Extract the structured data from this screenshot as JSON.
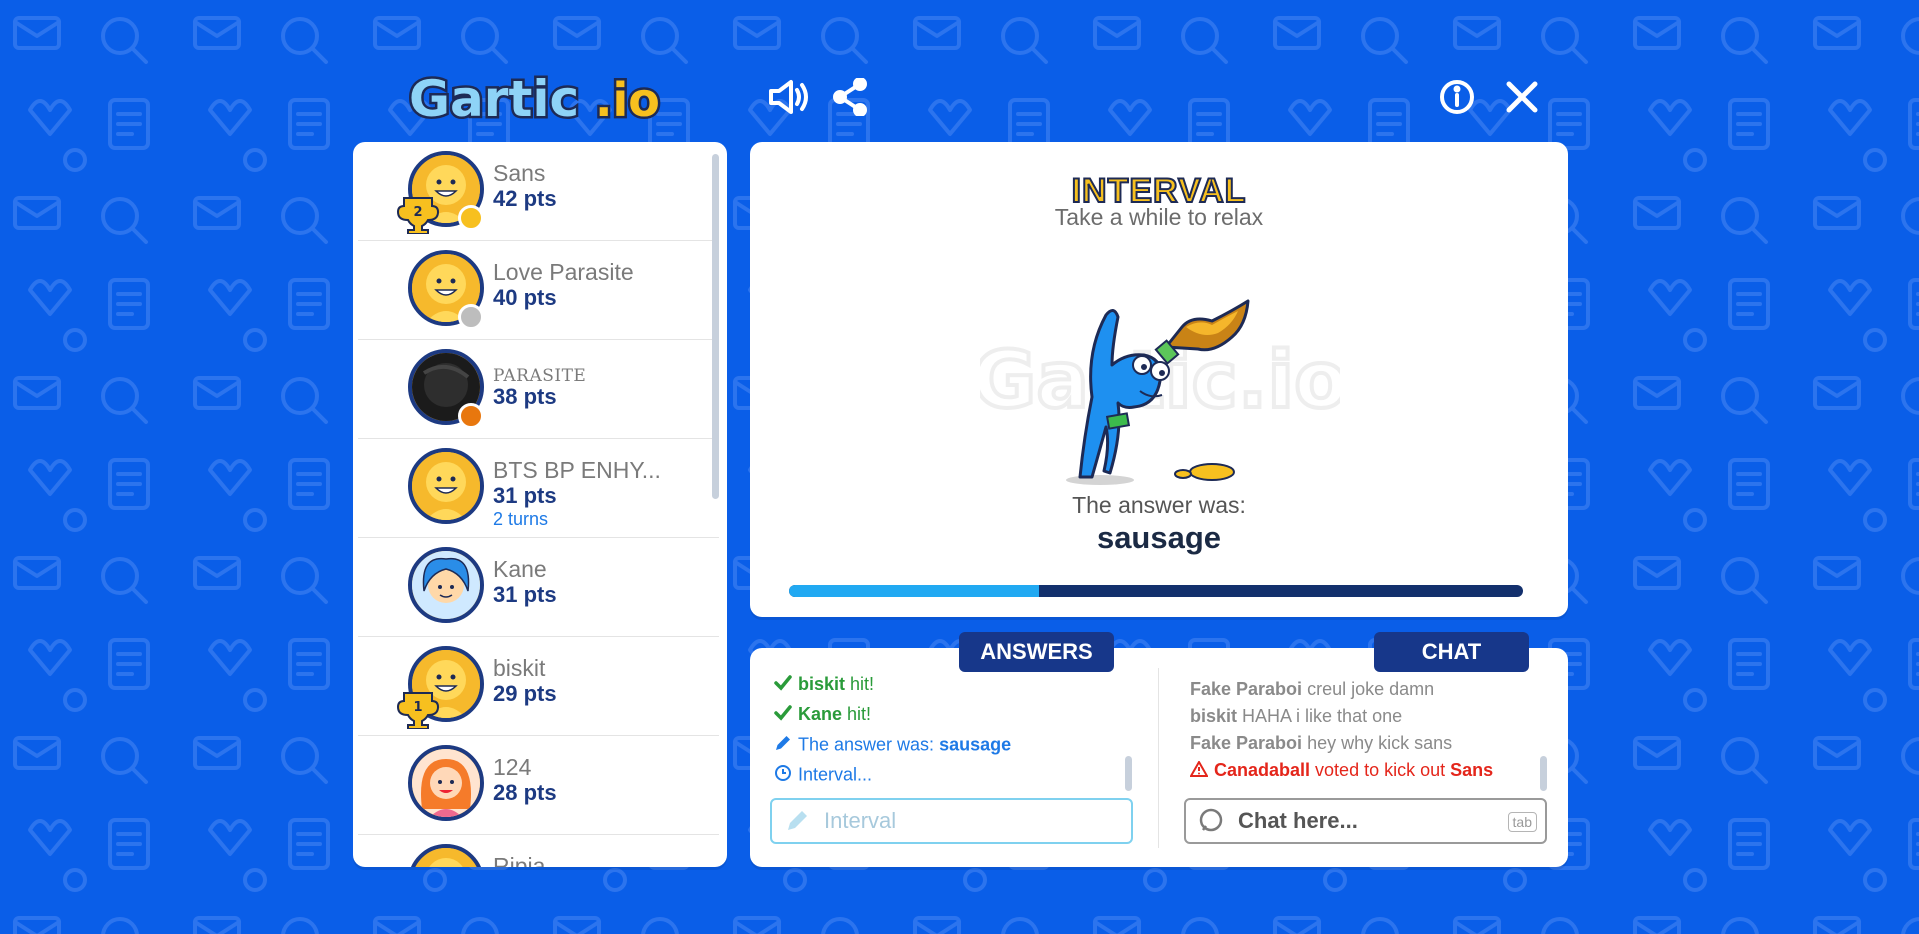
{
  "app": {
    "name": "Gartic.io"
  },
  "toolbar": {
    "sound_icon": "speaker-icon",
    "share_icon": "share-icon",
    "info_icon": "info-icon",
    "close_icon": "close-icon"
  },
  "players": [
    {
      "name": "Sans",
      "points": "42 pts",
      "badge": "2",
      "dot_color": "#f7c01f",
      "avatar": "default"
    },
    {
      "name": "Love Parasite",
      "points": "40 pts",
      "dot_color": "#bdbdbd",
      "avatar": "default"
    },
    {
      "name": "PARASITE",
      "points": "38 pts",
      "dot_color": "#e8770e",
      "avatar": "dark"
    },
    {
      "name": "BTS BP ENHY...",
      "points": "31 pts",
      "turns": "2 turns",
      "avatar": "default"
    },
    {
      "name": "Kane",
      "points": "31 pts",
      "avatar": "blue-hair"
    },
    {
      "name": "biskit",
      "points": "29 pts",
      "badge": "1",
      "avatar": "default"
    },
    {
      "name": "124",
      "points": "28 pts",
      "avatar": "orange-hair"
    },
    {
      "name": "Ripia",
      "avatar": "default"
    }
  ],
  "main": {
    "title": "INTERVAL",
    "subtitle": "Take a while to relax",
    "answer_label": "The answer was:",
    "answer": "sausage",
    "progress": 0.34
  },
  "answers": {
    "tab_label": "ANSWERS",
    "messages": [
      {
        "user": "biskit",
        "text": "hit!",
        "icon": "check-icon"
      },
      {
        "user": "Kane",
        "text": "hit!",
        "icon": "check-icon"
      },
      {
        "text": "The answer was:",
        "answer": "sausage",
        "icon": "pencil-icon"
      },
      {
        "text": "Interval...",
        "icon": "clock-icon"
      }
    ],
    "input_placeholder": "Interval"
  },
  "chat": {
    "tab_label": "CHAT",
    "messages": [
      {
        "user": "Fake Paraboi",
        "text": "creul joke damn"
      },
      {
        "user": "biskit",
        "text": "HAHA i like that one"
      },
      {
        "user": "Fake Paraboi",
        "text": "hey why kick sans"
      },
      {
        "user": "Canadaball",
        "text": "voted to kick out",
        "target": "Sans",
        "icon": "warning-icon"
      }
    ],
    "input_placeholder": "Chat here...",
    "shortcut": "tab"
  }
}
